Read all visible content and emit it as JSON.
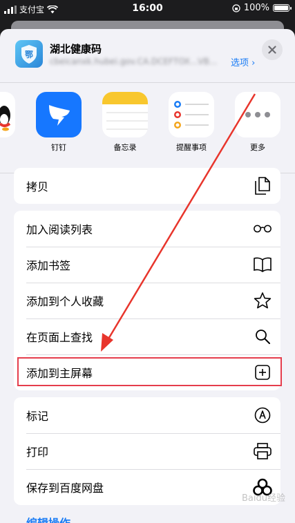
{
  "status_bar": {
    "carrier": "支付宝",
    "time": "16:00",
    "battery": "100%",
    "battery_level": 1.0
  },
  "header": {
    "app_name": "湖北健康码",
    "app_icon_text": "鄂",
    "url": "cbeicanxk.hubei.gov.CA.DCEFTOX...VB...",
    "options_label": "选项 ›"
  },
  "apps": [
    {
      "label": "",
      "icon": "qq-icon"
    },
    {
      "label": "钉钉",
      "icon": "dingtalk-icon"
    },
    {
      "label": "备忘录",
      "icon": "notes-icon"
    },
    {
      "label": "提醒事项",
      "icon": "reminders-icon"
    },
    {
      "label": "更多",
      "icon": "more-icon"
    }
  ],
  "actions": {
    "copy": {
      "label": "拷贝",
      "icon": "copy-icon"
    },
    "reading_list": {
      "label": "加入阅读列表",
      "icon": "glasses-icon"
    },
    "bookmark": {
      "label": "添加书签",
      "icon": "book-icon"
    },
    "favorites": {
      "label": "添加到个人收藏",
      "icon": "star-icon"
    },
    "find": {
      "label": "在页面上查找",
      "icon": "search-icon"
    },
    "home_screen": {
      "label": "添加到主屏幕",
      "icon": "add-square-icon"
    },
    "markup": {
      "label": "标记",
      "icon": "markup-icon"
    },
    "print": {
      "label": "打印",
      "icon": "printer-icon"
    },
    "baidu": {
      "label": "保存到百度网盘",
      "icon": "baidu-cloud-icon"
    }
  },
  "edit_actions_label": "编辑操作...",
  "watermark": "Baidu经验",
  "colors": {
    "accent": "#1a7cf5",
    "highlight": "#e53d4c",
    "sheet_bg": "#f2f2f7"
  }
}
